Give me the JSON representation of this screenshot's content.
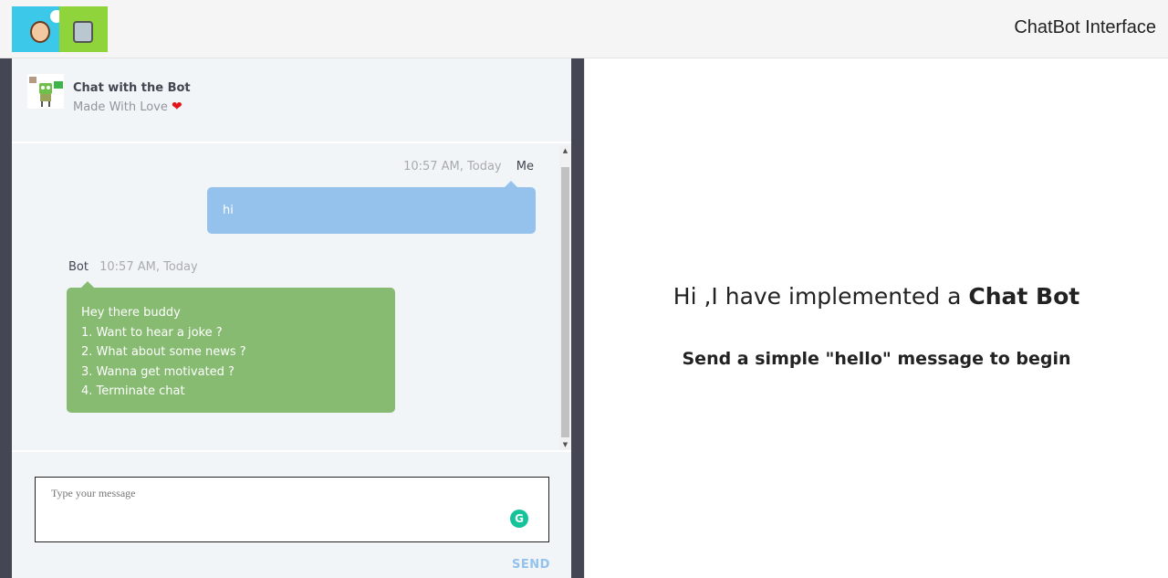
{
  "navbar": {
    "title": "ChatBot Interface"
  },
  "chat": {
    "header": {
      "title": "Chat with the Bot",
      "subtitle": "Made With Love",
      "heart": "❤"
    },
    "messages": [
      {
        "sender": "Me",
        "time": "10:57 AM, Today",
        "text": "hi"
      },
      {
        "sender": "Bot",
        "time": "10:57 AM, Today",
        "lines": [
          "Hey there buddy",
          "1. Want to hear a joke ?",
          "2. What about some news ?",
          "3. Wanna get motivated ?",
          "4. Terminate chat"
        ]
      }
    ],
    "composer": {
      "placeholder": "Type your message",
      "send_label": "SEND",
      "grammarly_letter": "G"
    }
  },
  "hero": {
    "title_prefix": "Hi ,I have implemented a ",
    "title_bold": "Chat Bot",
    "subtitle": "Send a simple \"hello\" message to begin"
  },
  "colors": {
    "me_bubble": "#94c2ed",
    "bot_bubble": "#86bb71",
    "frame": "#444753",
    "chat_bg": "#f2f5f8"
  },
  "icons": {
    "logo": "human-and-robot-logo",
    "bot_avatar": "robot-icon",
    "grammarly": "grammarly-icon"
  }
}
